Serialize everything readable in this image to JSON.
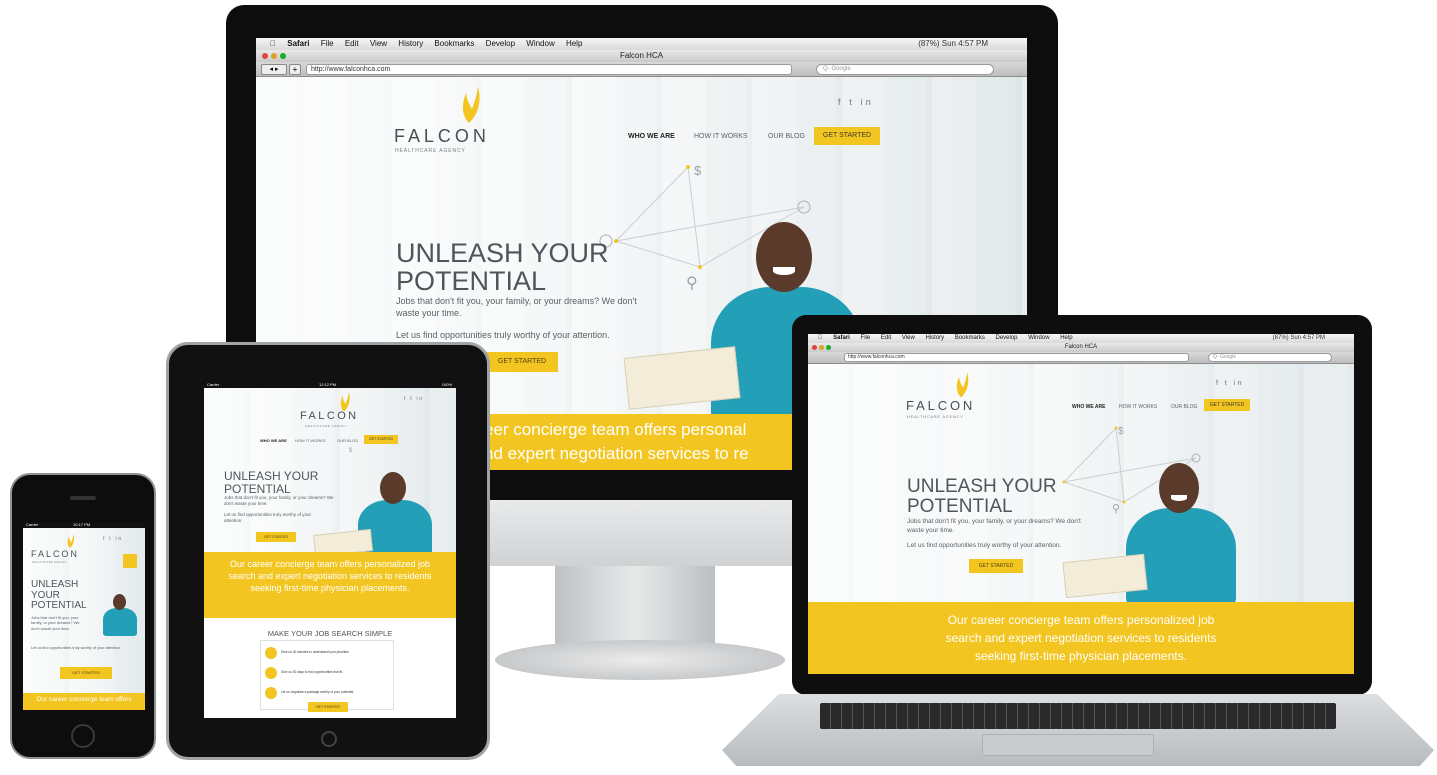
{
  "mac": {
    "menu": [
      "Safari",
      "File",
      "Edit",
      "View",
      "History",
      "Bookmarks",
      "Develop",
      "Window",
      "Help"
    ],
    "status": "(87%)  Sun 4:57 PM",
    "window_title": "Falcon HCA",
    "url": "http://www.falconhca.com",
    "search_placeholder": "Q- Google"
  },
  "site": {
    "brand": "FALCON",
    "tagline": "HEALTHCARE AGENCY",
    "social_icons": [
      "facebook-icon",
      "twitter-icon",
      "linkedin-icon"
    ],
    "social_glyphs": "f t in",
    "nav": {
      "who_we_are": "WHO WE ARE",
      "how_it_works": "HOW IT WORKS",
      "our_blog": "OUR BLOG",
      "get_started": "GET STARTED"
    },
    "headline_line1": "UNLEASH YOUR",
    "headline_line2": "POTENTIAL",
    "subtext": "Jobs that don't fit you, your family, or your dreams? We don't waste your time.",
    "subtext2": "Let us find opportunities truly worthy of your attention.",
    "cta": "GET STARTED",
    "band_full": "Our career concierge team offers personalized job search and expert negotiation services to residents seeking first-time physician placements.",
    "band_monitor_line1": "eer concierge team offers personal",
    "band_monitor_line2": "nd expert negotiation services to re",
    "band_laptop_line1": "Our career concierge team offers personalized job",
    "band_laptop_line2": "search and expert negotiation services to residents",
    "band_laptop_line3": "seeking first-time physician placements.",
    "band_phone": "Our career concierge team offers",
    "simple_title": "MAKE YOUR JOB SEARCH SIMPLE",
    "steps": [
      "Give us 30 minutes to understand your priorities.",
      "Give us 30 days to find opportunities that fit.",
      "Let us negotiate a package worthy of your potential."
    ],
    "phone_headline": [
      "UNLEASH",
      "YOUR",
      "POTENTIAL"
    ]
  },
  "ipad": {
    "carrier": "Carrier",
    "time": "12:12 PM",
    "battery": "100%"
  },
  "iphone": {
    "carrier": "Carrier",
    "time": "10:17 PM"
  },
  "hero_symbols": {
    "dollar": "$",
    "search": "⚲"
  }
}
